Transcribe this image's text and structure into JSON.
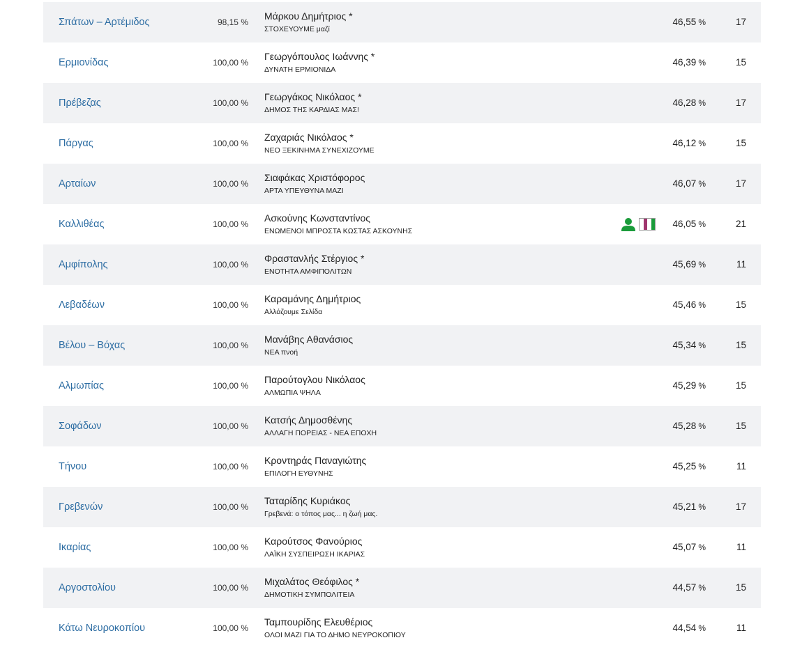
{
  "colors": {
    "link": "#2d6da3",
    "row_shade": "#f1f2f4",
    "icon_green": "#1a9b3a"
  },
  "percent_unit": "%",
  "rows": [
    {
      "municipality": "Σπάτων – Αρτέμιδος",
      "counted": "98,15 %",
      "name": "Μάρκου Δημήτριος *",
      "party": "ΣΤΟΧΕΥΟΥΜΕ μαζί",
      "percent": "46,55",
      "seats": "17"
    },
    {
      "municipality": "Ερμιονίδας",
      "counted": "100,00 %",
      "name": "Γεωργόπουλος Ιωάννης *",
      "party": "ΔΥΝΑΤΗ ΕΡΜΙΟΝΙΔΑ",
      "percent": "46,39",
      "seats": "15"
    },
    {
      "municipality": "Πρέβεζας",
      "counted": "100,00 %",
      "name": "Γεωργάκος Νικόλαος *",
      "party": "ΔΗΜΟΣ ΤΗΣ ΚΑΡΔΙΑΣ ΜΑΣ!",
      "percent": "46,28",
      "seats": "17"
    },
    {
      "municipality": "Πάργας",
      "counted": "100,00 %",
      "name": "Ζαχαριάς Νικόλαος *",
      "party": "ΝΕΟ ΞΕΚΙΝΗΜΑ ΣΥΝΕΧΙΖΟΥΜΕ",
      "percent": "46,12",
      "seats": "15"
    },
    {
      "municipality": "Αρταίων",
      "counted": "100,00 %",
      "name": "Σιαφάκας Χριστόφορος",
      "party": "ΑΡΤΑ ΥΠΕΥΘΥΝΑ ΜΑΖΙ",
      "percent": "46,07",
      "seats": "17"
    },
    {
      "municipality": "Καλλιθέας",
      "counted": "100,00 %",
      "name": "Ασκούνης Κωνσταντίνος",
      "party": "ΕΝΩΜΕΝΟΙ ΜΠΡΟΣΤΑ ΚΩΣΤΑΣ ΑΣΚΟΥΝΗΣ",
      "percent": "46,05",
      "seats": "21",
      "icons": [
        "person-icon",
        "flag-icon"
      ]
    },
    {
      "municipality": "Αμφίπολης",
      "counted": "100,00 %",
      "name": "Φραστανλής Στέργιος *",
      "party": "ΕΝΟΤΗΤΑ ΑΜΦΙΠΟΛΙΤΩΝ",
      "percent": "45,69",
      "seats": "11"
    },
    {
      "municipality": "Λεβαδέων",
      "counted": "100,00 %",
      "name": "Καραμάνης Δημήτριος",
      "party": "Αλλάζουμε Σελίδα",
      "percent": "45,46",
      "seats": "15"
    },
    {
      "municipality": "Βέλου – Βόχας",
      "counted": "100,00 %",
      "name": "Μανάβης Αθανάσιος",
      "party": "ΝΕΑ πνοή",
      "percent": "45,34",
      "seats": "15"
    },
    {
      "municipality": "Αλμωπίας",
      "counted": "100,00 %",
      "name": "Παρούτογλου Νικόλαος",
      "party": "ΑΛΜΩΠΙΑ ΨΗΛΑ",
      "percent": "45,29",
      "seats": "15"
    },
    {
      "municipality": "Σοφάδων",
      "counted": "100,00 %",
      "name": "Κατσής Δημοσθένης",
      "party": "ΑΛΛΑΓΗ ΠΟΡΕΙΑΣ - ΝΕΑ ΕΠΟΧΗ",
      "percent": "45,28",
      "seats": "15"
    },
    {
      "municipality": "Τήνου",
      "counted": "100,00 %",
      "name": "Κροντηράς Παναγιώτης",
      "party": "ΕΠΙΛΟΓΗ ΕΥΘΥΝΗΣ",
      "percent": "45,25",
      "seats": "11"
    },
    {
      "municipality": "Γρεβενών",
      "counted": "100,00 %",
      "name": "Ταταρίδης Κυριάκος",
      "party": "Γρεβενά: ο τόπος μας... η ζωή μας.",
      "percent": "45,21",
      "seats": "17"
    },
    {
      "municipality": "Ικαρίας",
      "counted": "100,00 %",
      "name": "Καρούτσος Φανούριος",
      "party": "ΛΑΪΚΗ ΣΥΣΠΕΙΡΩΣΗ ΙΚΑΡΙΑΣ",
      "percent": "45,07",
      "seats": "11"
    },
    {
      "municipality": "Αργοστολίου",
      "counted": "100,00 %",
      "name": "Μιχαλάτος Θεόφιλος *",
      "party": "ΔΗΜΟΤΙΚΗ ΣΥΜΠΟΛΙΤΕΙΑ",
      "percent": "44,57",
      "seats": "15"
    },
    {
      "municipality": "Κάτω Νευροκοπίου",
      "counted": "100,00 %",
      "name": "Ταμπουρίδης Ελευθέριος",
      "party": "ΟΛΟΙ ΜΑΖΙ ΓΙΑ ΤΟ ΔΗΜΟ ΝΕΥΡΟΚΟΠΙΟΥ",
      "percent": "44,54",
      "seats": "11"
    }
  ]
}
